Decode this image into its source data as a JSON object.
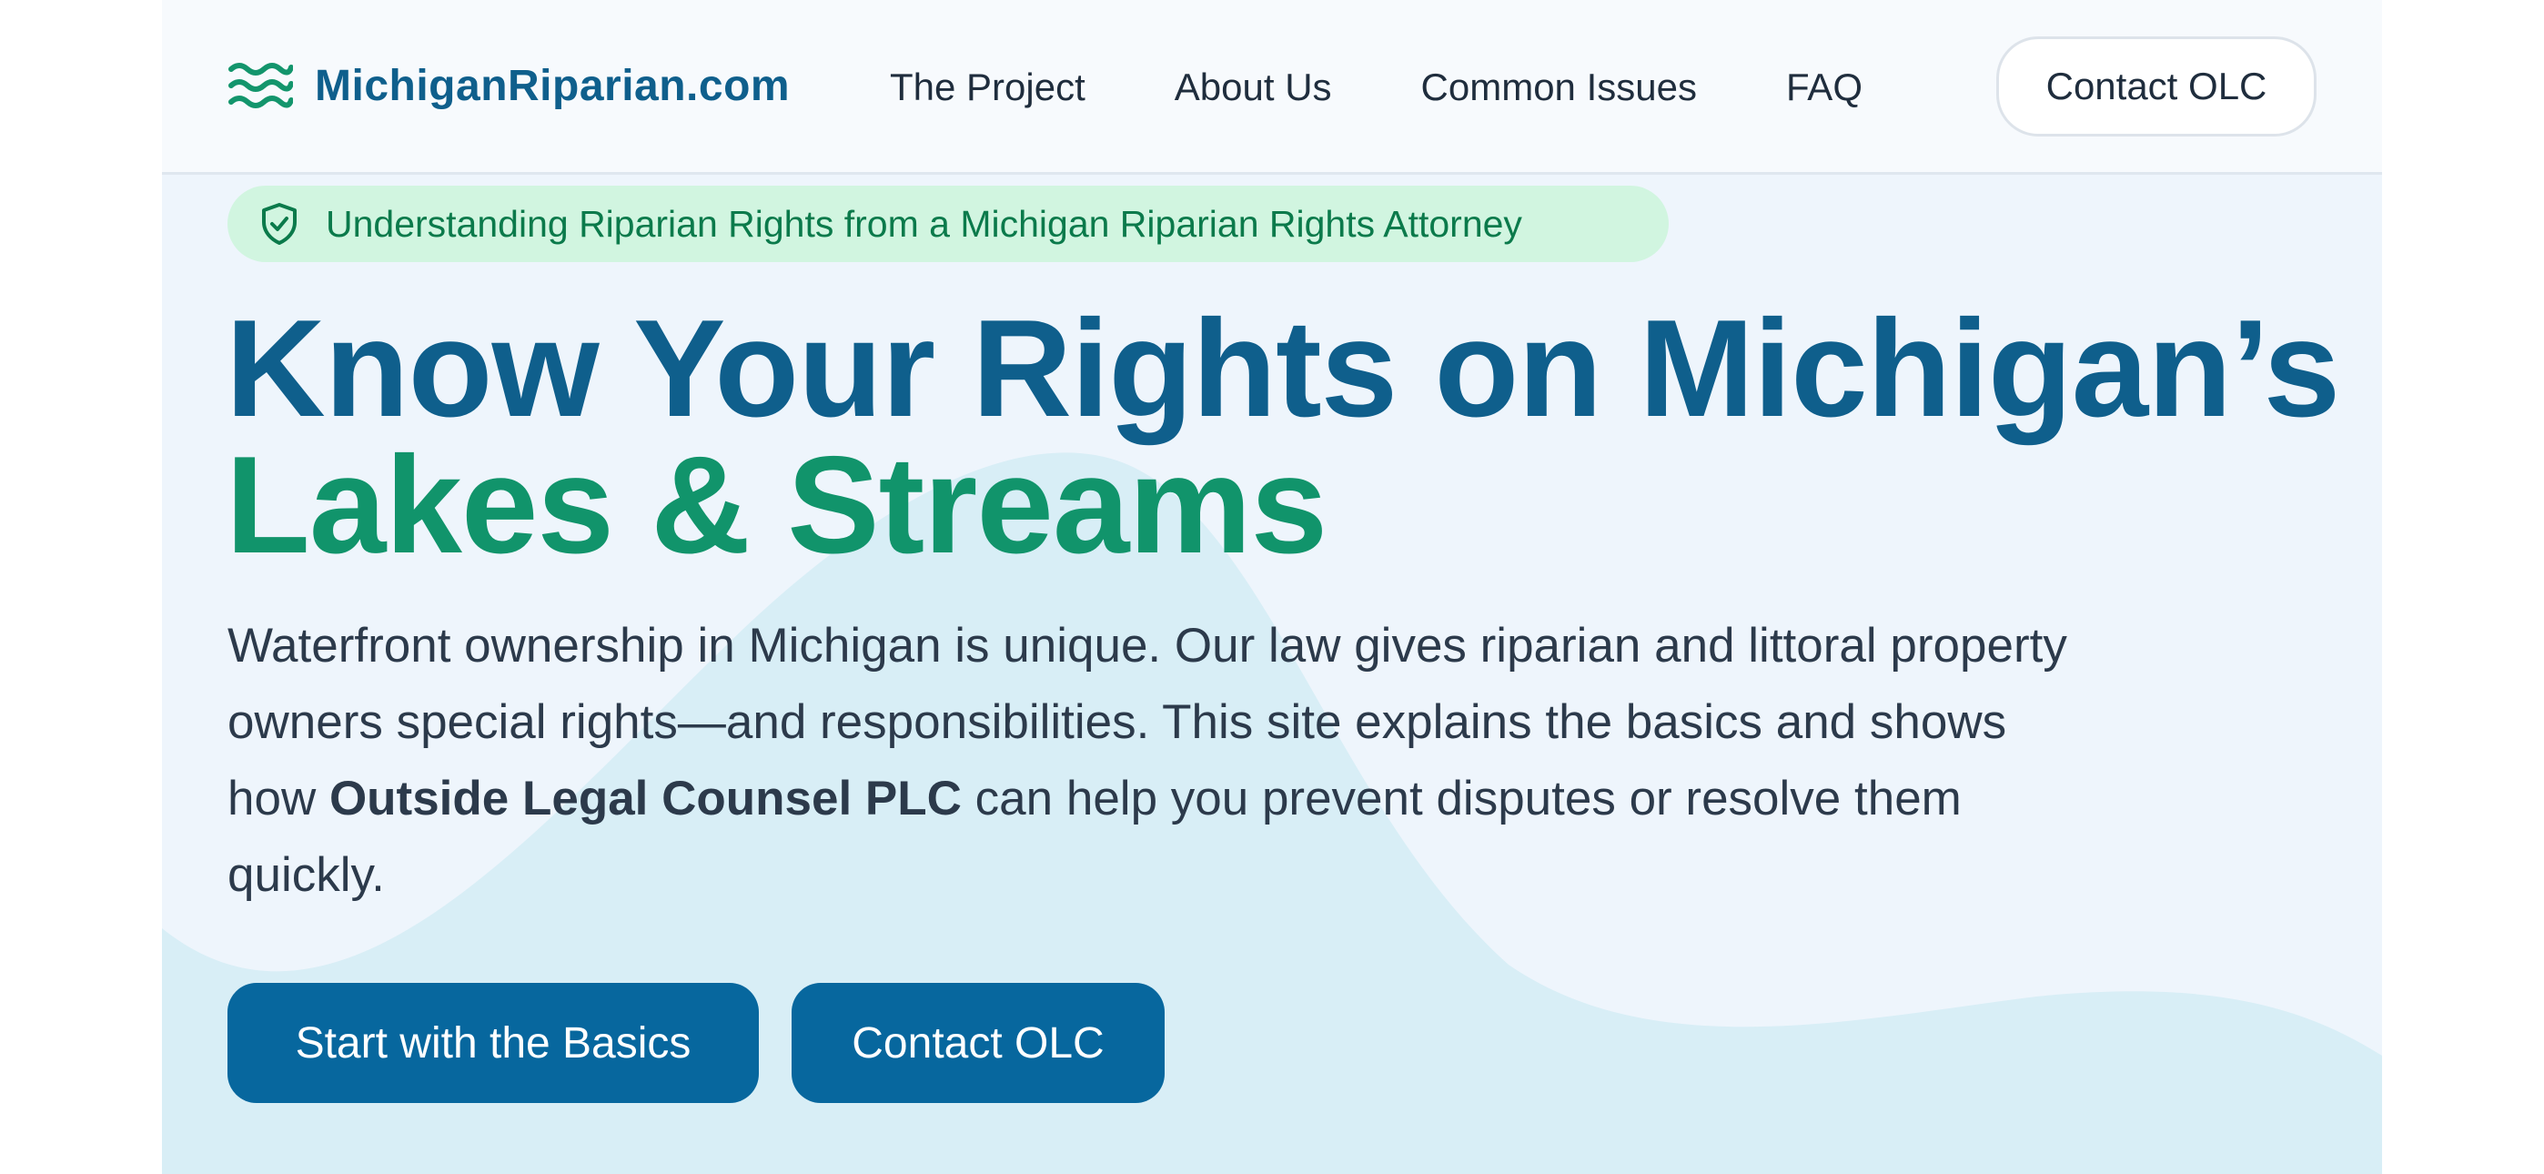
{
  "header": {
    "logo_text": "MichiganRiparian.com",
    "logo_icon": "waves-icon",
    "nav": [
      {
        "label": "The Project"
      },
      {
        "label": "About Us"
      },
      {
        "label": "Common Issues"
      },
      {
        "label": "FAQ"
      }
    ],
    "contact_label": "Contact OLC"
  },
  "hero": {
    "badge_icon": "shield-check-icon",
    "badge_text": "Understanding Riparian Rights from a Michigan Riparian Rights Attorney",
    "headline_line1": "Know Your Rights on Michigan’s",
    "headline_line2": "Lakes & Streams",
    "intro_before": "Waterfront ownership in Michigan is unique. Our law gives riparian and littoral property owners special rights—and responsibilities. This site explains the basics and shows how ",
    "intro_strong": "Outside Legal Counsel PLC",
    "intro_after": " can help you prevent disputes or resolve them quickly.",
    "cta_primary": "Start with the Basics",
    "cta_secondary": "Contact OLC"
  },
  "colors": {
    "brand_blue": "#0f5f8c",
    "brand_green": "#11946b",
    "button_blue": "#07679e",
    "badge_bg": "#d1f5e0"
  }
}
